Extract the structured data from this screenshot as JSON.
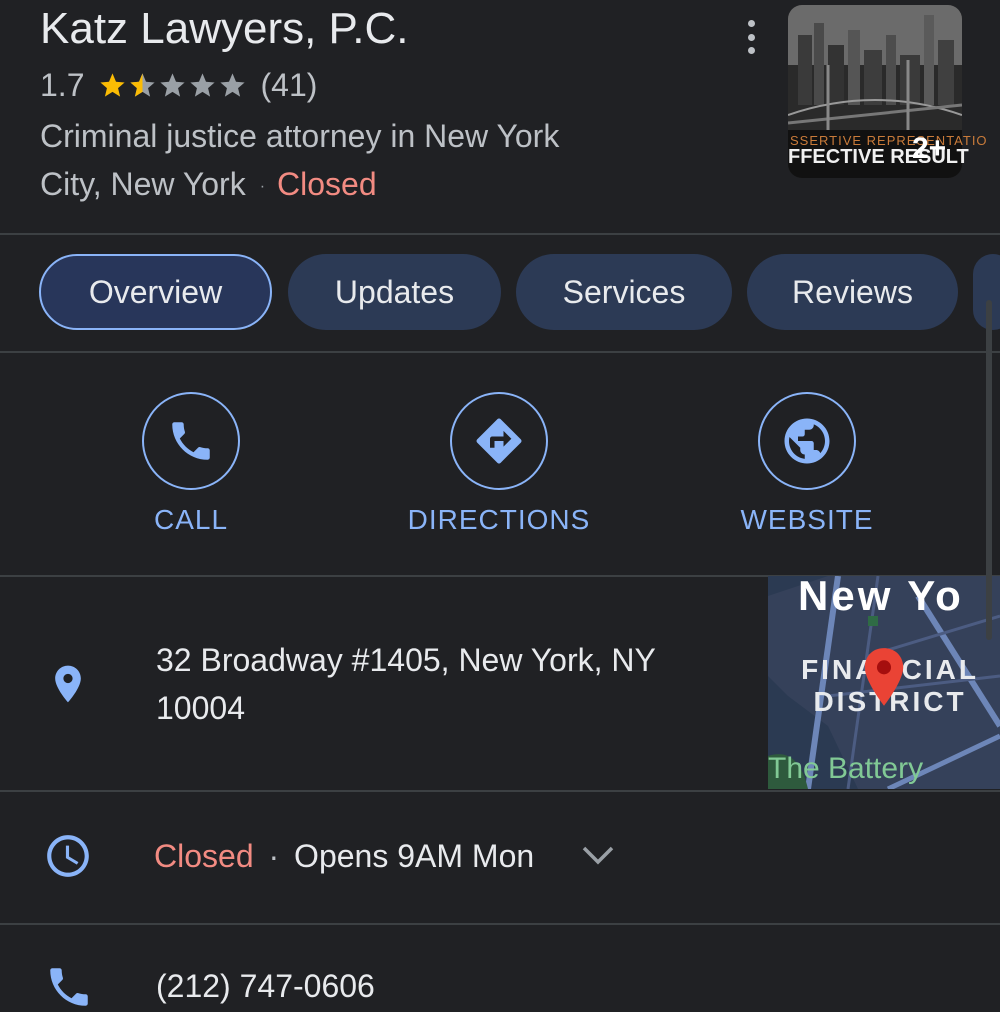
{
  "header": {
    "title": "Katz Lawyers, P.C.",
    "rating": "1.7",
    "rating_value": 1.7,
    "rating_max": 5,
    "review_count": "(41)",
    "category_line1": "Criminal justice attorney in New York",
    "category_line2": "City, New York",
    "separator": "·",
    "status": "Closed",
    "star_color": "#fbbc04",
    "star_empty_color": "#9aa0a6",
    "more_icon": "more-vert-icon"
  },
  "photo": {
    "count": "2+",
    "caption_line1": "SSERTIVE REPRESENTATIO",
    "caption_line2": "FFECTIVE RESULT"
  },
  "tabs": [
    {
      "label": "Overview",
      "active": true
    },
    {
      "label": "Updates",
      "active": false
    },
    {
      "label": "Services",
      "active": false
    },
    {
      "label": "Reviews",
      "active": false
    }
  ],
  "actions": [
    {
      "label": "CALL",
      "icon": "phone-icon"
    },
    {
      "label": "DIRECTIONS",
      "icon": "directions-icon"
    },
    {
      "label": "WEBSITE",
      "icon": "globe-icon"
    }
  ],
  "address": {
    "line1": "32 Broadway #1405, New York, NY",
    "line2": "10004",
    "icon": "location-pin-icon"
  },
  "map": {
    "title": "New Yo",
    "district_line1": "FINANCIAL",
    "district_line2": "DISTRICT",
    "landmark": "The Battery"
  },
  "hours": {
    "status": "Closed",
    "separator": "·",
    "next": "Opens 9AM Mon",
    "icon": "clock-icon"
  },
  "phone": {
    "number": "(212) 747-0606",
    "icon": "phone-icon"
  },
  "colors": {
    "background": "#202124",
    "accent": "#8ab4f8",
    "closed": "#f28b82",
    "tab_bg": "#2c3a55",
    "divider": "#3c4043"
  }
}
